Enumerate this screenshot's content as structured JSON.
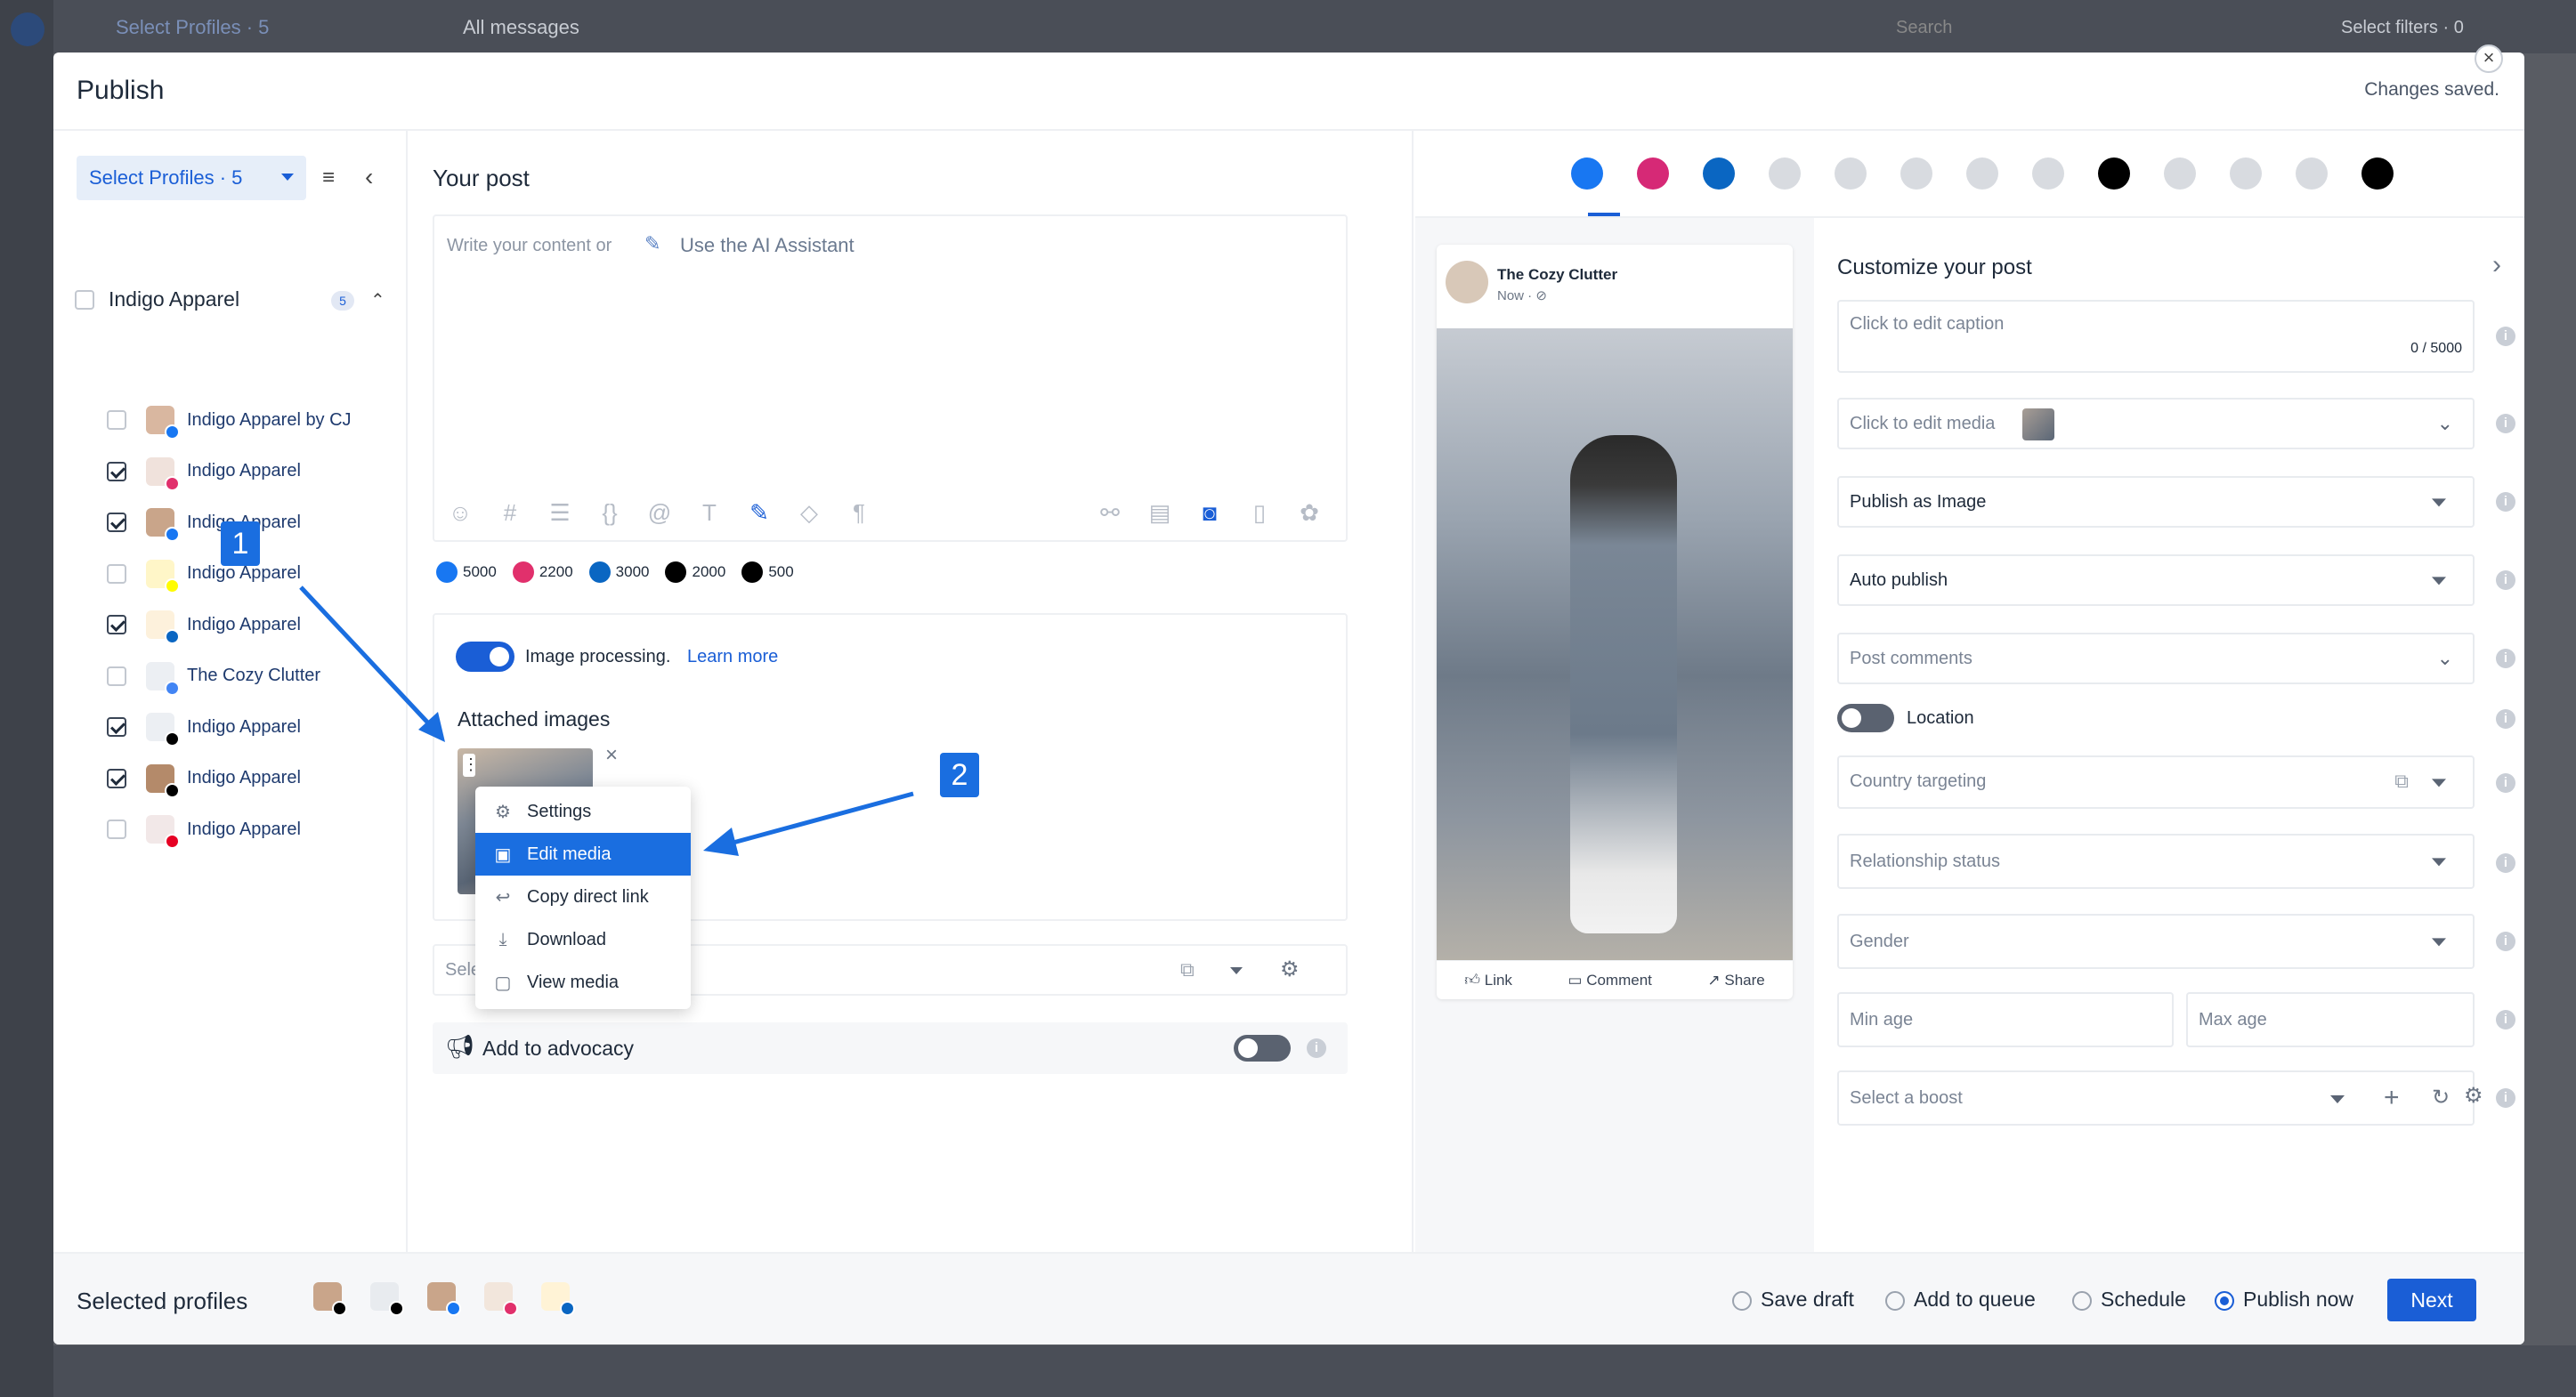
{
  "background": {
    "profiles_label": "Select Profiles · 5",
    "filter_label": "All messages",
    "search_placeholder": "Search",
    "filters_label": "Select filters · 0"
  },
  "modal": {
    "title": "Publish",
    "status": "Changes saved."
  },
  "profiles_panel": {
    "select_label": "Select Profiles · 5",
    "group_name": "Indigo Apparel",
    "group_count": "5",
    "items": [
      {
        "name": "Indigo Apparel by CJ",
        "checked": false,
        "network": "facebook",
        "network_color": "#1877f2"
      },
      {
        "name": "Indigo Apparel",
        "checked": true,
        "network": "instagram",
        "network_color": "#e1306c"
      },
      {
        "name": "Indigo Apparel",
        "checked": true,
        "network": "facebook",
        "network_color": "#1877f2"
      },
      {
        "name": "Indigo Apparel",
        "checked": false,
        "network": "snapchat",
        "network_color": "#fffc00"
      },
      {
        "name": "Indigo Apparel",
        "checked": true,
        "network": "linkedin",
        "network_color": "#0a66c2"
      },
      {
        "name": "The Cozy Clutter",
        "checked": false,
        "network": "google-business",
        "network_color": "#4285f4"
      },
      {
        "name": "Indigo Apparel",
        "checked": true,
        "network": "threads",
        "network_color": "#000000"
      },
      {
        "name": "Indigo Apparel",
        "checked": true,
        "network": "tiktok",
        "network_color": "#000000"
      },
      {
        "name": "Indigo Apparel",
        "checked": false,
        "network": "pinterest",
        "network_color": "#e60023"
      }
    ]
  },
  "editor": {
    "heading": "Your post",
    "placeholder": "Write your content or",
    "ai_link": "Use the AI Assistant",
    "limits": [
      {
        "network": "facebook",
        "value": "5000",
        "color": "#1877f2"
      },
      {
        "network": "instagram",
        "value": "2200",
        "color": "#e1306c"
      },
      {
        "network": "linkedin",
        "value": "3000",
        "color": "#0a66c2"
      },
      {
        "network": "tiktok",
        "value": "2000",
        "color": "#000000"
      },
      {
        "network": "threads",
        "value": "500",
        "color": "#000000"
      }
    ],
    "image_processing": "Image processing.",
    "learn_more": "Learn more",
    "attached_images": "Attached images",
    "select_placeholder": "Sele",
    "advocacy": "Add to advocacy"
  },
  "context_menu": {
    "items": [
      {
        "label": "Settings",
        "icon": "gear-icon",
        "glyph": "⚙",
        "selected": false
      },
      {
        "label": "Edit media",
        "icon": "edit-image-icon",
        "glyph": "▣",
        "selected": true
      },
      {
        "label": "Copy direct link",
        "icon": "reply-arrow-icon",
        "glyph": "↩",
        "selected": false
      },
      {
        "label": "Download",
        "icon": "download-icon",
        "glyph": "⤓",
        "selected": false
      },
      {
        "label": "View media",
        "icon": "view-image-icon",
        "glyph": "▢",
        "selected": false
      }
    ]
  },
  "annotations": {
    "step1": "1",
    "step2": "2"
  },
  "preview": {
    "networks": [
      {
        "name": "facebook",
        "color": "#1877f2"
      },
      {
        "name": "instagram",
        "color": "#d62976"
      },
      {
        "name": "linkedin",
        "color": "#0a66c2"
      },
      {
        "name": "x",
        "color": "#d8dbe0"
      },
      {
        "name": "youtube",
        "color": "#d8dbe0"
      },
      {
        "name": "google-business",
        "color": "#d8dbe0"
      },
      {
        "name": "reddit",
        "color": "#d8dbe0"
      },
      {
        "name": "pinterest",
        "color": "#d8dbe0"
      },
      {
        "name": "tiktok",
        "color": "#000000"
      },
      {
        "name": "snapchat",
        "color": "#d8dbe0"
      },
      {
        "name": "blogger",
        "color": "#d8dbe0"
      },
      {
        "name": "tumblr",
        "color": "#d8dbe0"
      },
      {
        "name": "threads",
        "color": "#000000"
      }
    ],
    "page_name": "The Cozy Clutter",
    "time": "Now · ⊘",
    "actions": {
      "like": "Link",
      "comment": "Comment",
      "share": "Share"
    }
  },
  "customize": {
    "heading": "Customize your post",
    "caption_placeholder": "Click to edit caption",
    "caption_count": "0 / 5000",
    "media_label": "Click to edit media",
    "publish_as": "Publish as Image",
    "auto_publish": "Auto publish",
    "post_comments": "Post comments",
    "location": "Location",
    "country": "Country targeting",
    "relationship": "Relationship status",
    "gender": "Gender",
    "min_age": "Min age",
    "max_age": "Max age",
    "boost": "Select a boost"
  },
  "footer": {
    "selected_label": "Selected profiles",
    "save_draft": "Save draft",
    "add_queue": "Add to queue",
    "schedule": "Schedule",
    "publish_now": "Publish now",
    "next": "Next"
  },
  "colors": {
    "accent": "#1a6ee0",
    "toggle_on": "#1a5ed6"
  }
}
